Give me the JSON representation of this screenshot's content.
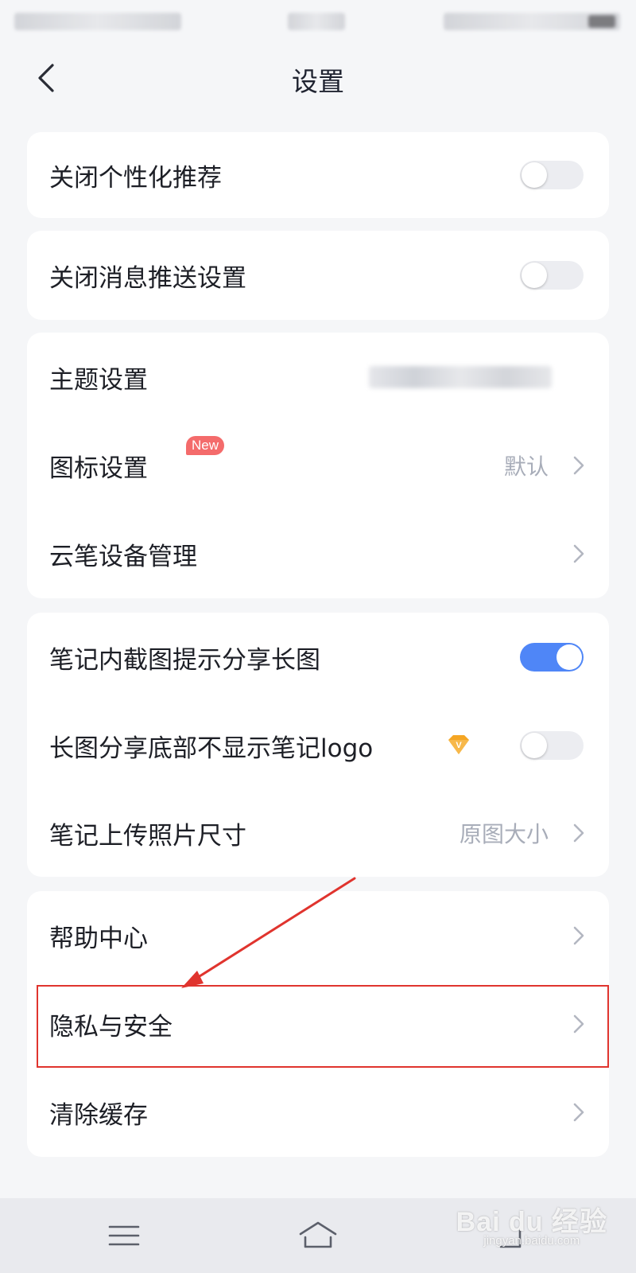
{
  "header": {
    "title": "设置",
    "back_icon": "chevron-left-icon"
  },
  "cards": {
    "personalized": {
      "label": "关闭个性化推荐",
      "toggle_on": false
    },
    "push": {
      "label": "关闭消息推送设置",
      "toggle_on": false
    },
    "appearance": {
      "theme_label": "主题设置",
      "icon_label": "图标设置",
      "icon_badge": "New",
      "icon_value": "默认",
      "pen_label": "云笔设备管理"
    },
    "sharing": {
      "screenshot_label": "笔记内截图提示分享长图",
      "screenshot_toggle_on": true,
      "logo_label": "长图分享底部不显示笔记logo",
      "logo_vip_badge": "V",
      "logo_toggle_on": false,
      "photo_label": "笔记上传照片尺寸",
      "photo_value": "原图大小"
    },
    "misc": {
      "help_label": "帮助中心",
      "privacy_label": "隐私与安全",
      "cache_label": "清除缓存"
    }
  },
  "colors": {
    "accent": "#4f86f7",
    "annotation": "#e0342e",
    "badge": "#f46b6b",
    "vip": "#f5a623"
  },
  "watermark": {
    "brand": "Bai du 经验",
    "site": "jingyan.baidu.com"
  }
}
